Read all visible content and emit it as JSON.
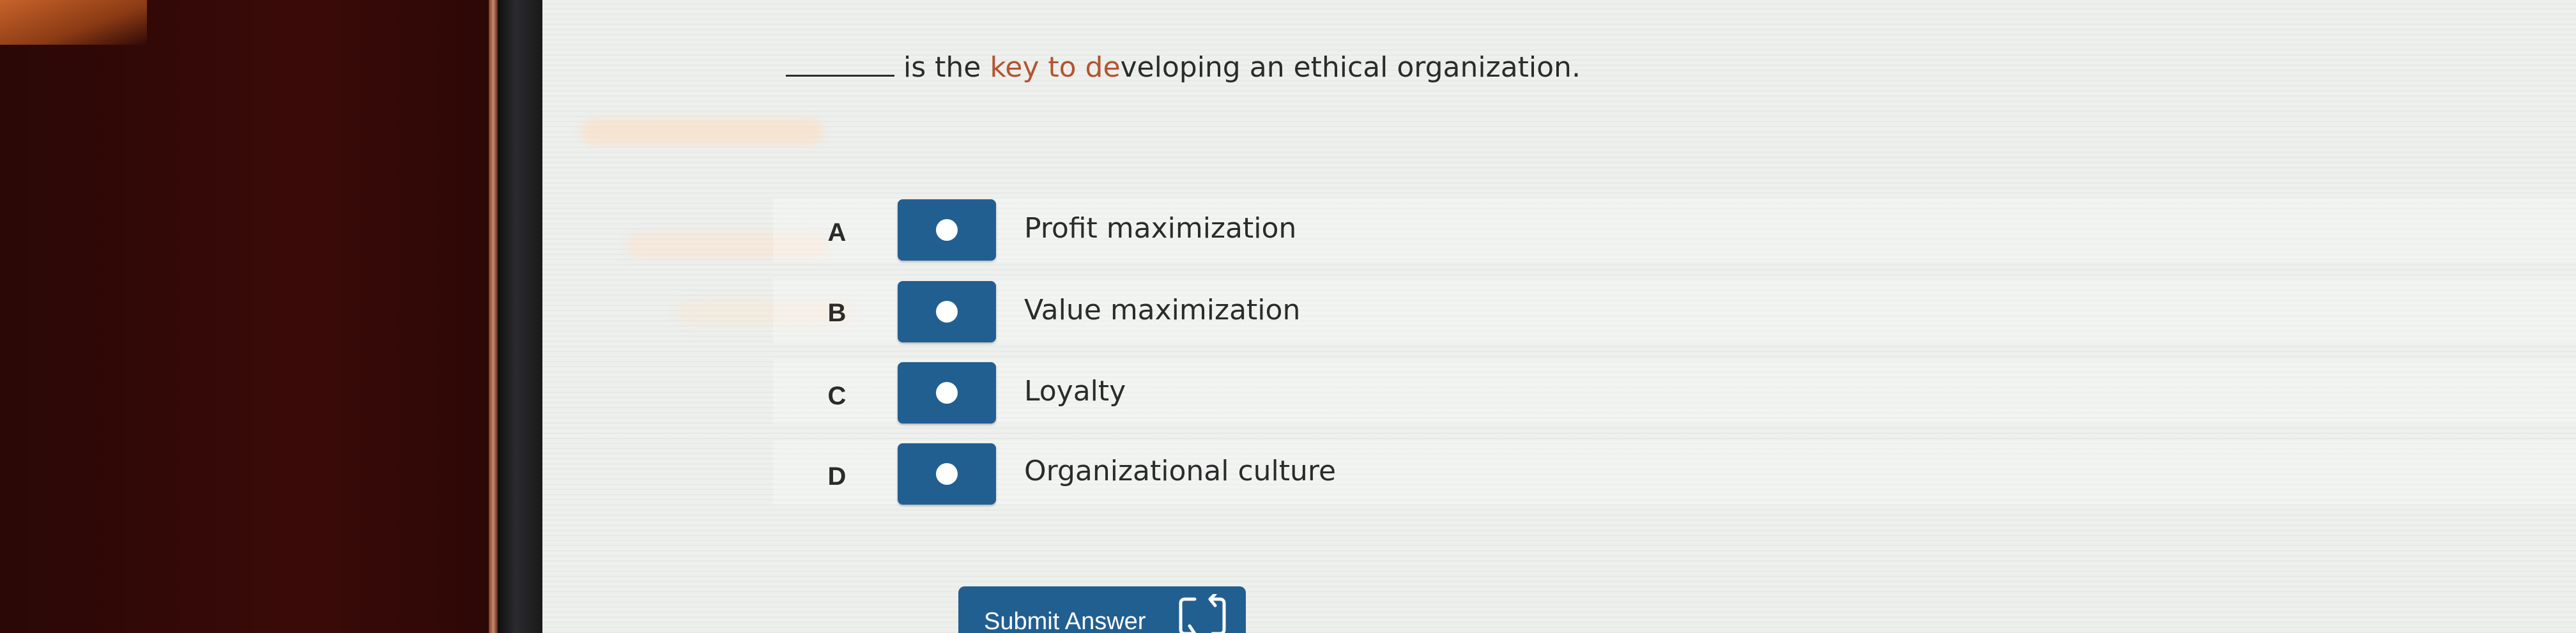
{
  "question": {
    "before_key": "is the ",
    "key_phrase": "key to de",
    "after_key": "veloping an ethical organization."
  },
  "options": [
    {
      "letter": "A",
      "text": "Profit maximization"
    },
    {
      "letter": "B",
      "text": "Value maximization"
    },
    {
      "letter": "C",
      "text": "Loyalty"
    },
    {
      "letter": "D",
      "text": "Organizational culture"
    }
  ],
  "submit": {
    "label": "Submit Answer",
    "icon": "swap-icon"
  },
  "colors": {
    "accent": "#225f91",
    "highlight": "#b3542e"
  }
}
